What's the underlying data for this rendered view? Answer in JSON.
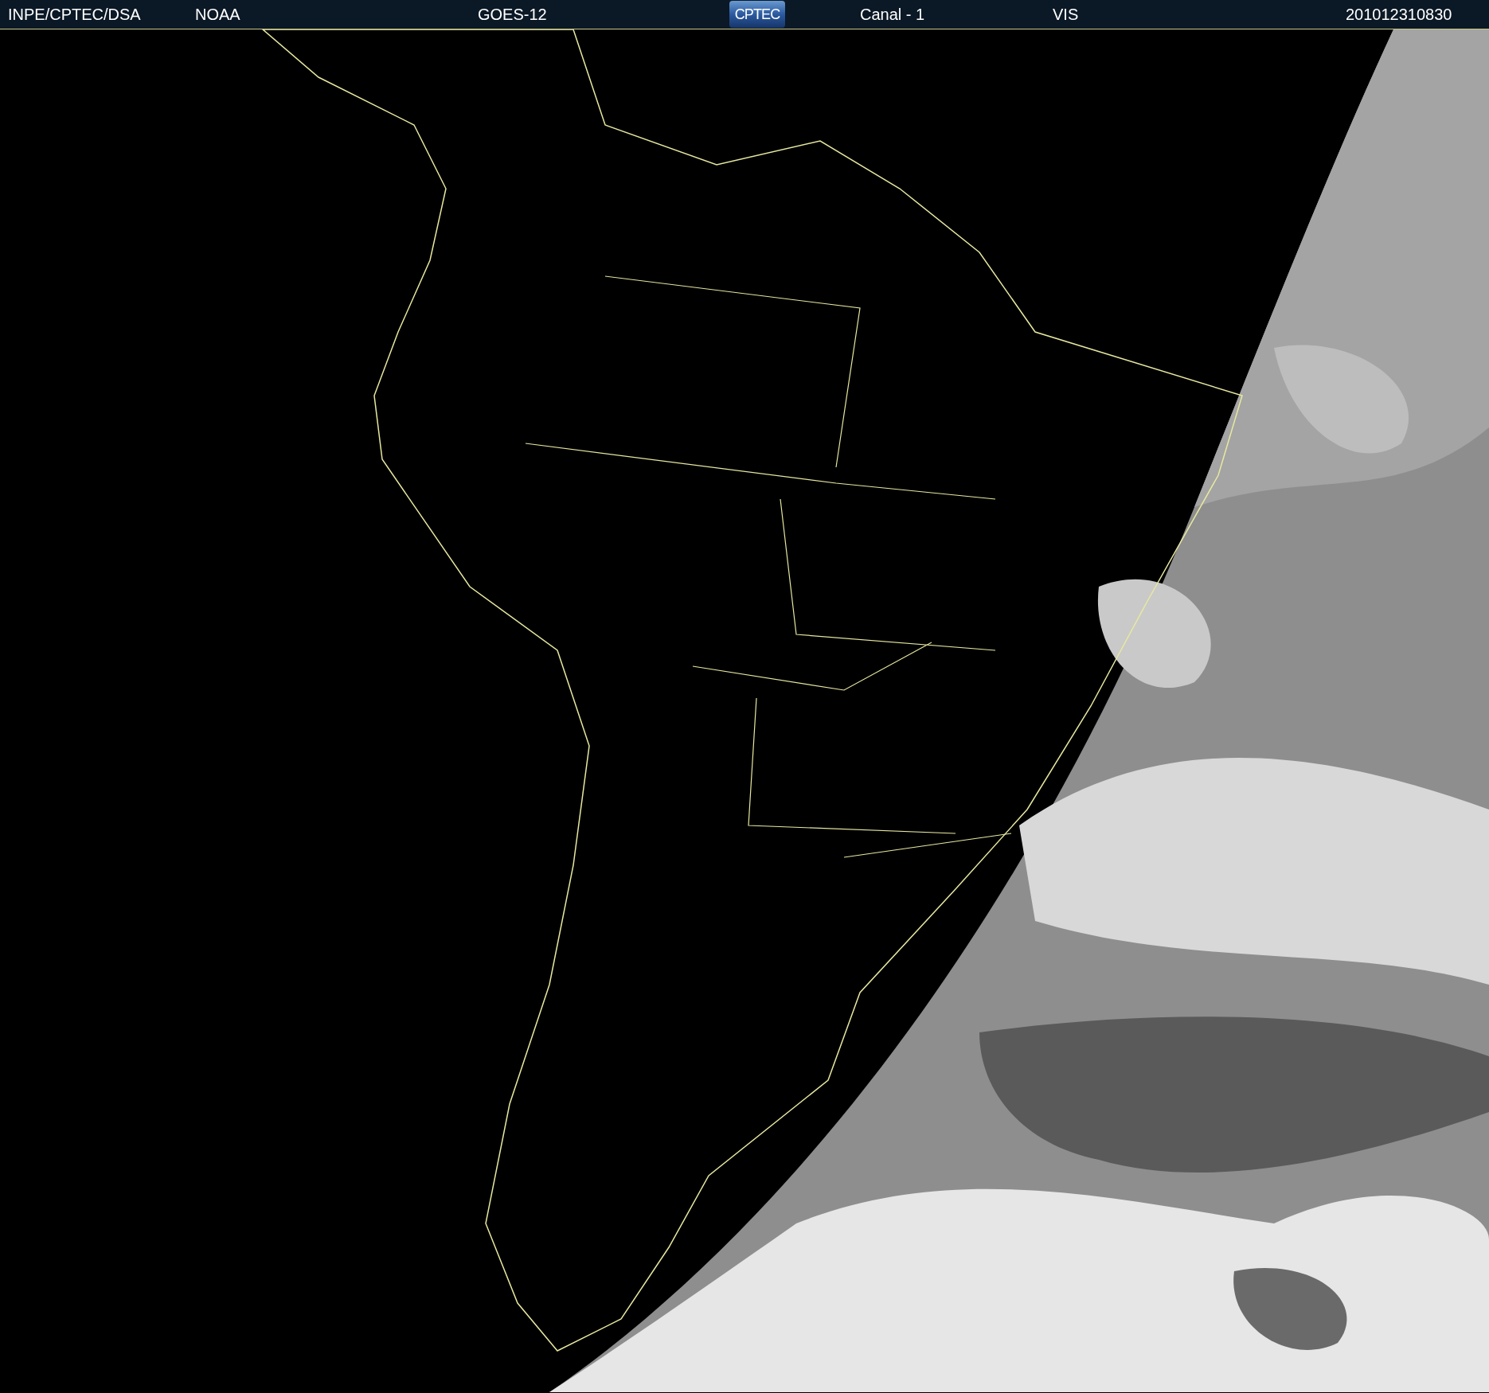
{
  "header": {
    "agency": "INPE/CPTEC/DSA",
    "source": "NOAA",
    "satellite": "GOES-12",
    "logo": "CPTEC",
    "channel": "Canal - 1",
    "band": "VIS",
    "timestamp": "201012310830"
  }
}
